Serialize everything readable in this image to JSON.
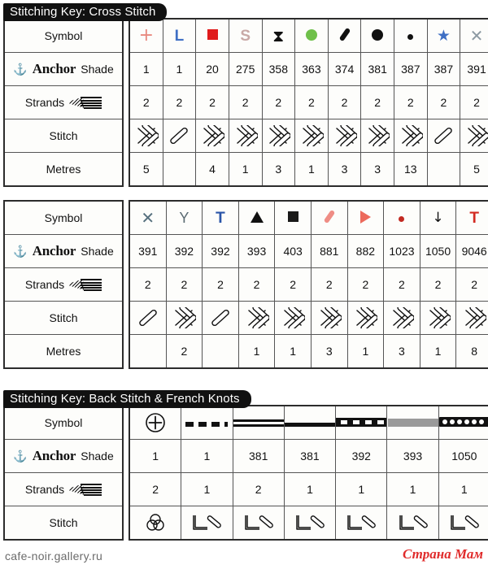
{
  "page": {
    "footer_url": "cafe-noir.gallery.ru",
    "watermark": "Страна Мам"
  },
  "row_labels": {
    "symbol": "Symbol",
    "anchor_brand": "Anchor",
    "shade": "Shade",
    "strands": "Strands",
    "stitch": "Stitch",
    "metres": "Metres"
  },
  "tables": [
    {
      "id": "cross-stitch-1",
      "banner": "Stitching Key: Cross Stitch",
      "columns": [
        {
          "symbol": {
            "glyph": "plus",
            "color": "#e8897f",
            "label": "+"
          },
          "shade": "1",
          "strands": "2",
          "stitch": "cross",
          "metres": "5"
        },
        {
          "symbol": {
            "glyph": "letter",
            "color": "#3f6fc4",
            "label": "L"
          },
          "shade": "1",
          "strands": "2",
          "stitch": "half",
          "metres": ""
        },
        {
          "symbol": {
            "glyph": "square",
            "color": "#e01b1b",
            "label": "■"
          },
          "shade": "20",
          "strands": "2",
          "stitch": "cross",
          "metres": "4"
        },
        {
          "symbol": {
            "glyph": "letter",
            "color": "#c9a9a6",
            "label": "S"
          },
          "shade": "275",
          "strands": "2",
          "stitch": "cross",
          "metres": "1"
        },
        {
          "symbol": {
            "glyph": "hourglass",
            "color": "#111111",
            "label": "⧖"
          },
          "shade": "358",
          "strands": "2",
          "stitch": "cross",
          "metres": "3"
        },
        {
          "symbol": {
            "glyph": "circle",
            "color": "#6fc04a",
            "label": "●"
          },
          "shade": "363",
          "strands": "2",
          "stitch": "cross",
          "metres": "1"
        },
        {
          "symbol": {
            "glyph": "slash",
            "color": "#111111",
            "label": "/"
          },
          "shade": "374",
          "strands": "2",
          "stitch": "cross",
          "metres": "3"
        },
        {
          "symbol": {
            "glyph": "circle",
            "color": "#111111",
            "label": "●"
          },
          "shade": "381",
          "strands": "2",
          "stitch": "cross",
          "metres": "3"
        },
        {
          "symbol": {
            "glyph": "dot",
            "color": "#111111",
            "label": "•"
          },
          "shade": "387",
          "strands": "2",
          "stitch": "cross",
          "metres": "13"
        },
        {
          "symbol": {
            "glyph": "star",
            "color": "#3f6fc4",
            "label": "★"
          },
          "shade": "387",
          "strands": "2",
          "stitch": "half",
          "metres": ""
        },
        {
          "symbol": {
            "glyph": "cross-x",
            "color": "#8d9aa3",
            "label": "✕"
          },
          "shade": "391",
          "strands": "2",
          "stitch": "cross",
          "metres": "5"
        }
      ]
    },
    {
      "id": "cross-stitch-2",
      "banner": "",
      "columns": [
        {
          "symbol": {
            "glyph": "cross-x",
            "color": "#56707e",
            "label": "✕"
          },
          "shade": "391",
          "strands": "2",
          "stitch": "half",
          "metres": ""
        },
        {
          "symbol": {
            "glyph": "letter-y",
            "color": "#5a6a72",
            "label": "Y"
          },
          "shade": "392",
          "strands": "2",
          "stitch": "cross",
          "metres": "2"
        },
        {
          "symbol": {
            "glyph": "letter",
            "color": "#2a55a8",
            "label": "T"
          },
          "shade": "392",
          "strands": "2",
          "stitch": "half",
          "metres": ""
        },
        {
          "symbol": {
            "glyph": "triangle",
            "color": "#111111",
            "label": "▲"
          },
          "shade": "393",
          "strands": "2",
          "stitch": "cross",
          "metres": "1"
        },
        {
          "symbol": {
            "glyph": "square",
            "color": "#1a1a1a",
            "label": "■"
          },
          "shade": "403",
          "strands": "2",
          "stitch": "cross",
          "metres": "1"
        },
        {
          "symbol": {
            "glyph": "slash",
            "color": "#ef8d85",
            "label": "/"
          },
          "shade": "881",
          "strands": "2",
          "stitch": "cross",
          "metres": "3"
        },
        {
          "symbol": {
            "glyph": "triangle-right",
            "color": "#ec6a5c",
            "label": "▶"
          },
          "shade": "882",
          "strands": "2",
          "stitch": "cross",
          "metres": "1"
        },
        {
          "symbol": {
            "glyph": "dot",
            "color": "#c22a22",
            "label": "•"
          },
          "shade": "1023",
          "strands": "2",
          "stitch": "cross",
          "metres": "3"
        },
        {
          "symbol": {
            "glyph": "arrow-down",
            "color": "#111111",
            "label": "↓"
          },
          "shade": "1050",
          "strands": "2",
          "stitch": "cross",
          "metres": "1"
        },
        {
          "symbol": {
            "glyph": "letter",
            "color": "#d32a22",
            "label": "T"
          },
          "shade": "9046",
          "strands": "2",
          "stitch": "cross",
          "metres": "8"
        }
      ]
    }
  ],
  "backstitch_table": {
    "id": "back-stitch",
    "banner": "Stitching Key: Back Stitch & French Knots",
    "columns": [
      {
        "symbol": {
          "glyph": "circled-plus",
          "color": "#111111",
          "label": "⊕"
        },
        "shade": "1",
        "strands": "2",
        "stitch": "french-knot"
      },
      {
        "symbol": {
          "glyph": "dashed-line",
          "color": "#111111",
          "label": "- - -"
        },
        "shade": "1",
        "strands": "1",
        "stitch": "back-stitch"
      },
      {
        "symbol": {
          "glyph": "double-line",
          "color": "#111111",
          "label": "="
        },
        "shade": "381",
        "strands": "2",
        "stitch": "back-stitch"
      },
      {
        "symbol": {
          "glyph": "solid-line",
          "color": "#111111",
          "label": "—"
        },
        "shade": "381",
        "strands": "1",
        "stitch": "back-stitch"
      },
      {
        "symbol": {
          "glyph": "ticked-line",
          "color": "#111111",
          "label": "▭▭▭"
        },
        "shade": "392",
        "strands": "1",
        "stitch": "back-stitch"
      },
      {
        "symbol": {
          "glyph": "grey-line",
          "color": "#9a9a9a",
          "label": "—"
        },
        "shade": "393",
        "strands": "1",
        "stitch": "back-stitch"
      },
      {
        "symbol": {
          "glyph": "beaded-line",
          "color": "#111111",
          "label": "•••"
        },
        "shade": "1050",
        "strands": "1",
        "stitch": "back-stitch"
      }
    ]
  }
}
